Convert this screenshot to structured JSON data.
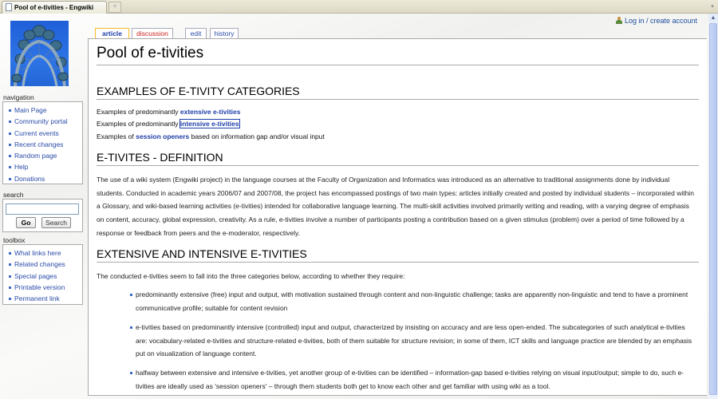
{
  "browser": {
    "tab_title": "Pool of e-tivities - Engwiki",
    "new_tab_symbol": "+",
    "tab_menu_symbol": "▾"
  },
  "personal_tools": {
    "login_label": "Log in / create account",
    "icon": "user-icon"
  },
  "content_tabs": [
    {
      "label": "article",
      "state": "selected"
    },
    {
      "label": "discussion",
      "state": "new"
    },
    {
      "label": "edit",
      "state": "normal"
    },
    {
      "label": "history",
      "state": "normal"
    }
  ],
  "sidebar": {
    "logo": "london-eye-logo",
    "navigation": {
      "heading": "navigation",
      "items": [
        "Main Page",
        "Community portal",
        "Current events",
        "Recent changes",
        "Random page",
        "Help",
        "Donations"
      ]
    },
    "search": {
      "heading": "search",
      "input_value": "",
      "go_label": "Go",
      "search_label": "Search"
    },
    "toolbox": {
      "heading": "toolbox",
      "items": [
        "What links here",
        "Related changes",
        "Special pages",
        "Printable version",
        "Permanent link"
      ]
    }
  },
  "article": {
    "title": "Pool of e-tivities",
    "section1": {
      "heading": "EXAMPLES OF E-TIVITY CATEGORIES",
      "lines": [
        {
          "prefix": "Examples of predominantly ",
          "link": "extensive e-tivities",
          "suffix": ""
        },
        {
          "prefix": "Examples of predominantly ",
          "link": "intensive e-tivities",
          "suffix": ""
        },
        {
          "prefix": "Examples of ",
          "link": "session openers",
          "suffix": " based on information gap and/or visual input"
        }
      ]
    },
    "section2": {
      "heading": "E-TIVITES - DEFINITION",
      "paragraph": "The use of a wiki system (Engwiki project) in the language courses at the Faculty of Organization and Informatics was introduced as an alternative to traditional assignments done by individual students. Conducted in academic years 2006/07 and 2007/08, the project has encompassed postings of two main types: articles initially created and posted by individual students – incorporated within a Glossary, and wiki-based learning activities (e-tivities) intended for collaborative language learning. The multi-skill activities involved primarily writing and reading, with a varying degree of emphasis on content, accuracy, global expression, creativity. As a rule, e-tivities involve a number of participants posting a contribution based on a given stimulus (problem) over a period of time followed by a response or feedback from peers and the e-moderator, respectively."
    },
    "section3": {
      "heading": "EXTENSIVE AND INTENSIVE E-TIVITIES",
      "intro": "The conducted e-tivities seem to fall into the three categories below, according to whether they require:",
      "items": [
        "predominantly extensive (free) input and output, with motivation sustained through content and non-linguistic challenge; tasks are apparently non-linguistic and tend to have a prominent communicative profile; suitable for content revision",
        "e-tivities based on predominantly intensive (controlled) input and output, characterized by insisting on accuracy and are less open-ended. The subcategories of such analytical e-tivities are: vocabulary-related e-tivities and structure-related e-tivities, both of them suitable for structure revision; in some of them, ICT skills and language practice are blended by an emphasis put on visualization of language content.",
        "halfway between extensive and intensive e-tivities, yet another group of e-tivities can be identified – information-gap based e-tivities relying on visual input/output; simple to do, such e-tivities are ideally used as 'session openers' – through them students both get to know each other and get familiar with using wiki as a tool."
      ]
    }
  }
}
